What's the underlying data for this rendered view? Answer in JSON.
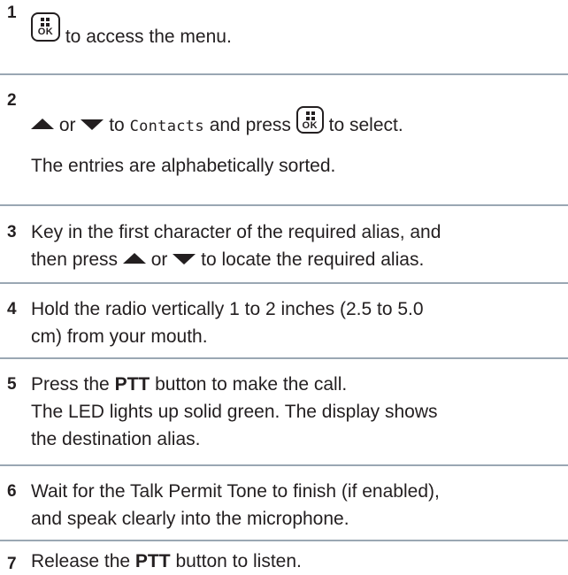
{
  "steps": [
    {
      "number": "1",
      "lines": [
        "to access the menu."
      ]
    },
    {
      "number": "2",
      "or": "or",
      "to": "to",
      "target": "Contacts",
      "press": "and press",
      "select": "to select.",
      "sub": "The entries are alphabetically sorted."
    },
    {
      "number": "3",
      "line1": "Key in the first character of the required alias, and",
      "then_press": "then press",
      "or": "or",
      "locate": "to locate the required alias."
    },
    {
      "number": "4",
      "line1": "Hold the radio vertically 1 to 2 inches (2.5 to 5.0",
      "line2": "cm) from your mouth."
    },
    {
      "number": "5",
      "press": "Press the",
      "ptt": "PTT",
      "rest": "button to make the call.",
      "line2": "The LED lights up solid green. The display shows",
      "line3": "the destination alias."
    },
    {
      "number": "6",
      "line1": "Wait for the Talk Permit Tone to finish (if enabled),",
      "line2": "and speak clearly into the microphone."
    },
    {
      "number": "7",
      "release": "Release the",
      "ptt": "PTT",
      "rest": "button to listen."
    }
  ],
  "icons": {
    "menu_ok_key": "OK",
    "up": "up-arrow-icon",
    "down": "down-arrow-icon"
  },
  "colors": {
    "text": "#231f20",
    "rule": "#9aa7b3"
  }
}
